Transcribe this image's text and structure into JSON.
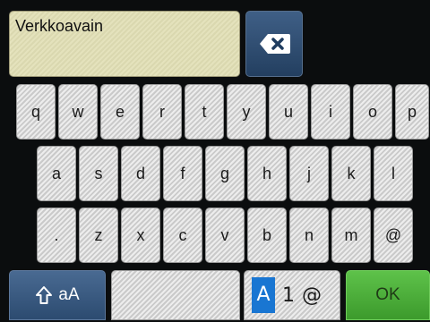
{
  "input": {
    "value": "Verkkoavain"
  },
  "backspace": {
    "icon": "backspace-icon"
  },
  "keys": {
    "row1": [
      "q",
      "w",
      "e",
      "r",
      "t",
      "y",
      "u",
      "i",
      "o",
      "p"
    ],
    "row2": [
      "a",
      "s",
      "d",
      "f",
      "g",
      "h",
      "j",
      "k",
      "l"
    ],
    "row3": [
      ".",
      "z",
      "x",
      "c",
      "v",
      "b",
      "n",
      "m",
      "@"
    ]
  },
  "bottom": {
    "shift_label": "aA",
    "mode_a": "A",
    "mode_1": "1",
    "mode_at": "@",
    "ok_label": "OK"
  },
  "colors": {
    "input_bg": "#e1dfb5",
    "blue_key": "#3a5a82",
    "ok_green": "#4eb03a",
    "mode_highlight": "#1976d2"
  }
}
